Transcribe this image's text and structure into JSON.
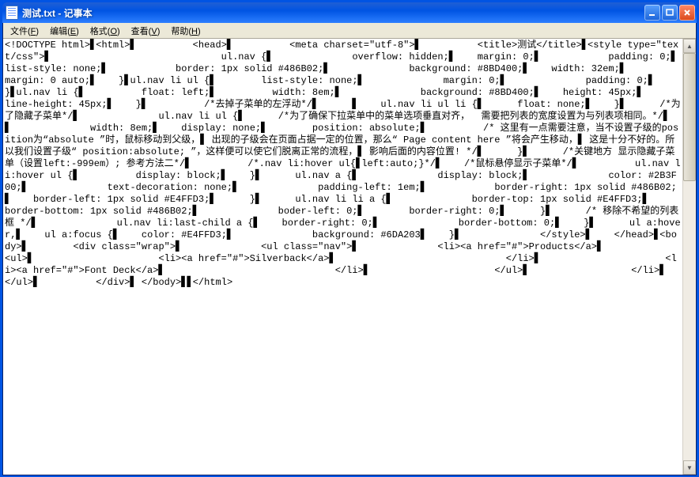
{
  "window": {
    "title": "测试.txt - 记事本"
  },
  "menu": {
    "file": "文件",
    "file_hk": "F",
    "edit": "编辑",
    "edit_hk": "E",
    "format": "格式",
    "format_hk": "O",
    "view": "查看",
    "view_hk": "V",
    "help": "帮助",
    "help_hk": "H"
  },
  "content": "<!DOCTYPE html>▋<html>▋          <head>▋          <meta charset=\"utf-8\">▋          <title>测试</title>▋<style type=\"text/css\">▋                              ul.nav {▋              overflow: hidden;▋    margin: 0;▋            padding: 0;▋            list-style: none;▋            border: 1px solid #486B02;▋              background: #8BD400;▋    width: 32em;▋            margin: 0 auto;▋    }▋ul.nav li ul {▋        list-style: none;▋              margin: 0;▋              padding: 0;▋    }▋ul.nav li {▋          float: left;▋          width: 8em;▋              background: #8BD400;▋    height: 45px;▋        line-height: 45px;▋    }▋          /*去掉子菜单的左浮动*/▋      ▋    ul.nav li ul li {▋      float: none;▋    }▋      /*为了隐藏子菜单*/▋              ul.nav li ul {▋      /*为了确保下拉菜单中的菜单选项垂直对齐，  需要把列表的宽度设置为与列表项相同。*/▋              ▋              width: 8em;▋    display: none;▋        position: absolute;▋          /* 这里有一点需要注意，当不设置子级的position为“absolute ”时，鼠标移动到父级，▋ 出现的子级会在页面占据一定的位置，那么“ Page content here ”将会产生移动，▋ 这是十分不好的。所以我们设置子级“ position:absolute; ”，这样便可以使它们脱离正常的流程，▋ 影响后面的内容位置! */▋      }▋      /*关键地方 显示隐藏子菜单（设置left:-999em）; 参考方法二*/▋          /*.nav li:hover ul{▋left:auto;}*/▋    /*鼠标悬停显示子菜单*/▋          ul.nav li:hover ul {▋          display: block;▋    }▋      ul.nav a {▋              display: block;▋              color: #2B3F00;▋              text-decoration: none;▋              padding-left: 1em;▋            border-right: 1px solid #486B02;▋    border-left: 1px solid #E4FFD3;▋      }▋      ul.nav li li a {▋              border-top: 1px solid #E4FFD3;▋              border-bottom: 1px solid #486B02;▋              boder-left: 0;▋        border-right: 0;▋      }▋      /* 移除不希望的列表框 */▋              ul.nav li:last-child a {▋    border-right: 0;▋              border-bottom: 0;▋    }▋      ul a:hover,▋    ul a:focus {▋    color: #E4FFD3;▋              background: #6DA203▋    }▋              </style>▋    </head>▋<body>▋        <div class=\"wrap\">▋              <ul class=\"nav\">▋              <li><a href=\"#\">Products</a>▋                              <ul>▋                      <li><a href=\"#\">Silverback</a>▋                              </li>▋                      <li><a href=\"#\">Font Deck</a>▋                              </li>▋                      </ul>▋                  </li>▋              </ul>▋          </div>▋ </body>▋▋</html>"
}
